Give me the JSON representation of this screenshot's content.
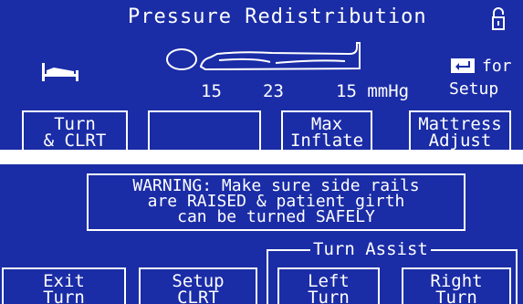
{
  "top_screen": {
    "title": "Pressure Redistribution",
    "pressures": [
      "15",
      "23",
      "15 mmHg"
    ],
    "hint_line1": "↵ for",
    "hint_line2": "Setup",
    "softkeys": [
      {
        "line1": "Turn",
        "line2": "& CLRT"
      },
      {
        "line1": "",
        "line2": ""
      },
      {
        "line1": "Max",
        "line2": "Inflate"
      },
      {
        "line1": "Mattress",
        "line2": "Adjust"
      }
    ],
    "icons": [
      "lock-icon",
      "bed-icon",
      "patient-outline-icon",
      "enter-key-icon"
    ]
  },
  "bottom_screen": {
    "warning_lines": [
      "WARNING: Make sure side rails",
      "are RAISED & patient girth",
      "can be turned SAFELY"
    ],
    "group_label": "Turn Assist",
    "softkeys": [
      {
        "line1": "Exit",
        "line2": "Turn"
      },
      {
        "line1": "Setup",
        "line2": "CLRT"
      },
      {
        "line1": "Left",
        "line2": "Turn"
      },
      {
        "line1": "Right",
        "line2": "Turn"
      }
    ]
  },
  "colors": {
    "screen_background": "#1a2ca6",
    "foreground": "#ffffff",
    "page_background": "#ffffff"
  }
}
